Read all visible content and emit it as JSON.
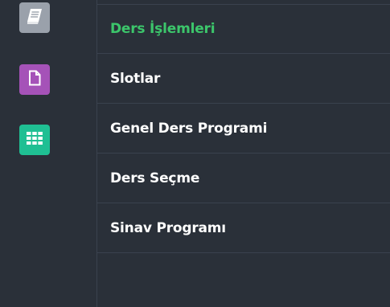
{
  "sidebar": {
    "icons": [
      {
        "name": "notebook-icon",
        "color": "#9aa1ab"
      },
      {
        "name": "document-icon",
        "color": "#a552b8"
      },
      {
        "name": "grid-table-icon",
        "color": "#1fbf93"
      }
    ]
  },
  "menu": {
    "active_color": "#3cc66b",
    "items": [
      {
        "label": "Ders İşlemleri",
        "active": true
      },
      {
        "label": "Slotlar",
        "active": false
      },
      {
        "label": "Genel Ders Programi",
        "active": false
      },
      {
        "label": "Ders Seçme",
        "active": false
      },
      {
        "label": "Sinav Programı",
        "active": false
      }
    ]
  }
}
